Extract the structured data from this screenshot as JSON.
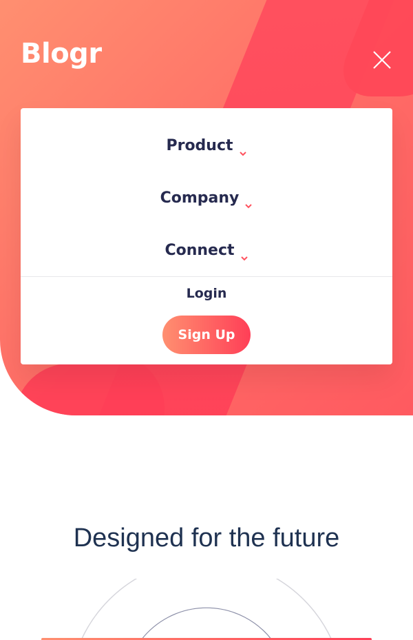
{
  "brand": {
    "logo": "Blogr"
  },
  "nav": {
    "items": [
      {
        "label": "Product"
      },
      {
        "label": "Company"
      },
      {
        "label": "Connect"
      }
    ],
    "login_label": "Login",
    "signup_label": "Sign Up"
  },
  "icons": {
    "close": "close-icon",
    "chevron": "chevron-down-icon"
  },
  "section": {
    "title": "Designed for the future"
  },
  "colors": {
    "accent_start": "#ff8f70",
    "accent_end": "#ff3f57",
    "menu_text": "#262a4f",
    "heading": "#1f3251"
  }
}
